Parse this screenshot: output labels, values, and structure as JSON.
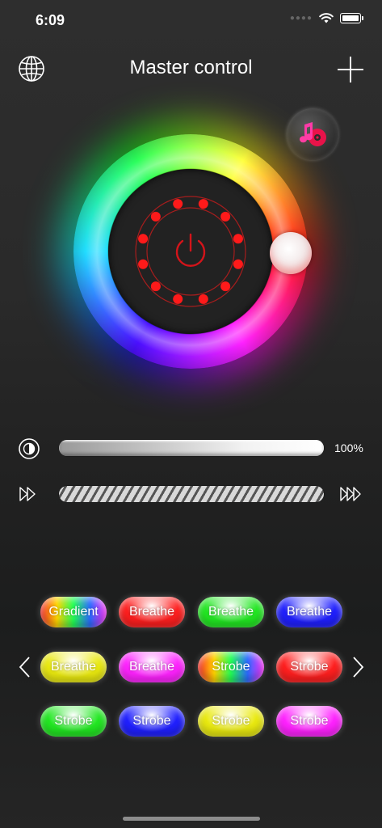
{
  "status_bar": {
    "time": "6:09"
  },
  "header": {
    "title": "Master control"
  },
  "icons": {
    "globe": "globe-icon",
    "add": "plus-icon",
    "music": "music-mode-icon",
    "power": "power-icon",
    "brightness": "brightness-icon",
    "speed": "speed-icon"
  },
  "color_wheel": {
    "selected_color": "#ff1a1a"
  },
  "brightness": {
    "value": 100,
    "label": "100%"
  },
  "speed": {
    "value": 100
  },
  "effects": [
    {
      "label": "Gradient",
      "colors": [
        "#ff2b2b",
        "#ffd500",
        "#22ff55",
        "#2b6bff",
        "#ff2bff"
      ]
    },
    {
      "label": "Breathe",
      "colors": [
        "#ff1f1f"
      ]
    },
    {
      "label": "Breathe",
      "colors": [
        "#22e822"
      ]
    },
    {
      "label": "Breathe",
      "colors": [
        "#2020ff"
      ]
    },
    {
      "label": "Breathe",
      "colors": [
        "#eaea10"
      ]
    },
    {
      "label": "Breathe",
      "colors": [
        "#ff22ff"
      ]
    },
    {
      "label": "Strobe",
      "colors": [
        "#ff2b2b",
        "#ffd500",
        "#22ff55",
        "#2b6bff",
        "#ff2bff"
      ]
    },
    {
      "label": "Strobe",
      "colors": [
        "#ff1f1f"
      ]
    },
    {
      "label": "Strobe",
      "colors": [
        "#22e822"
      ]
    },
    {
      "label": "Strobe",
      "colors": [
        "#2020ff"
      ]
    },
    {
      "label": "Strobe",
      "colors": [
        "#eaea10"
      ]
    },
    {
      "label": "Strobe",
      "colors": [
        "#ff22ff"
      ]
    }
  ]
}
